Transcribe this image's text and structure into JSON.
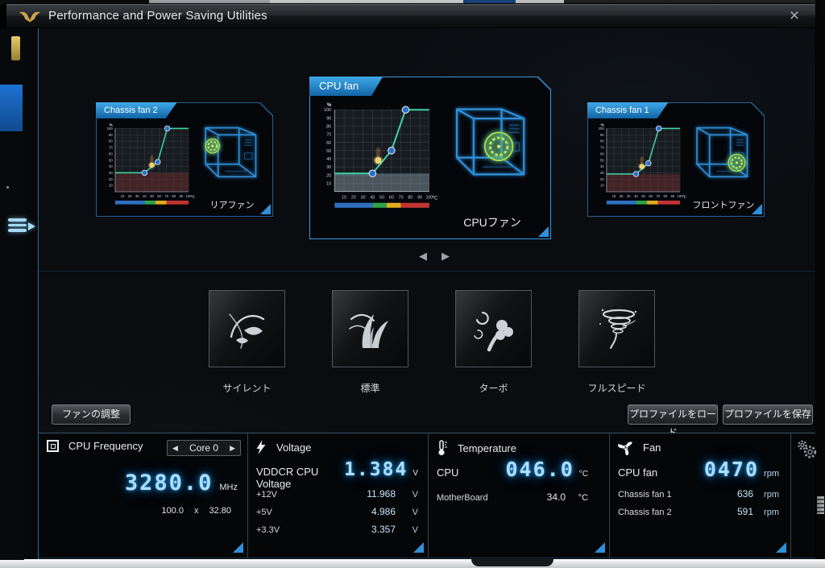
{
  "window": {
    "title": "Performance and Power Saving Utilities",
    "close_glyph": "×"
  },
  "icons": {
    "titlebar_logo": "tuf-eagle-logo",
    "menu_handle": "slide-out-menu-icon",
    "cpu_frequency": "chip-icon",
    "voltage": "lightning-icon",
    "temperature": "thermometer-icon",
    "fan": "fan-icon",
    "settings": "gears-icon"
  },
  "carousel": {
    "prev_glyph": "◀",
    "next_glyph": "▶"
  },
  "fan_cards": [
    {
      "title": "Chassis fan 2",
      "fan_label": "リアファン",
      "fan_position": "rear",
      "selected": false
    },
    {
      "title": "CPU fan",
      "fan_label": "CPUファン",
      "fan_position": "center",
      "selected": true
    },
    {
      "title": "Chassis fan 1",
      "fan_label": "フロントファン",
      "fan_position": "front",
      "selected": false
    }
  ],
  "modes": [
    {
      "label": "サイレント",
      "icon": "silent-leaf-wind-icon"
    },
    {
      "label": "標準",
      "icon": "standard-grass-wind-icon"
    },
    {
      "label": "ターボ",
      "icon": "turbo-wind-flower-icon"
    },
    {
      "label": "フルスピード",
      "icon": "full-speed-tornado-icon"
    }
  ],
  "actions": {
    "fan_tuning": "ファンの調整",
    "load_profile": "プロファイルをロード",
    "save_profile": "プロファイルを保存"
  },
  "monitor": {
    "cpu_frequency": {
      "title": "CPU Frequency",
      "selector_prev": "◀",
      "selector_value": "Core 0",
      "selector_next": "▶",
      "value": "3280.0",
      "unit": "MHz",
      "bclk": "100.0",
      "mult_sign": "x",
      "multiplier": "32.80"
    },
    "voltage": {
      "title": "Voltage",
      "main_label": "VDDCR CPU Voltage",
      "main_value": "1.384",
      "main_unit": "V",
      "rows": [
        {
          "label": "+12V",
          "value": "11.968",
          "unit": "V"
        },
        {
          "label": "+5V",
          "value": "4.986",
          "unit": "V"
        },
        {
          "label": "+3.3V",
          "value": "3.357",
          "unit": "V"
        }
      ]
    },
    "temperature": {
      "title": "Temperature",
      "main_label": "CPU",
      "main_value": "046.0",
      "main_unit": "°C",
      "rows": [
        {
          "label": "MotherBoard",
          "value": "34.0",
          "unit": "°C"
        }
      ]
    },
    "fan": {
      "title": "Fan",
      "main_label": "CPU fan",
      "main_value": "0470",
      "main_unit": "rpm",
      "rows": [
        {
          "label": "Chassis fan 1",
          "value": "636",
          "unit": "rpm"
        },
        {
          "label": "Chassis fan 2",
          "value": "591",
          "unit": "rpm"
        }
      ]
    }
  },
  "colors": {
    "accent_blue": "#1e8fd5",
    "tab_blue": "#1a7fd0",
    "glow_value": "#ace0ff",
    "curve_green": "#3ed3a3",
    "point_blue": "#2e6fc4",
    "marker_yellow": "#f2cf58",
    "triangle_blue": "#2f8fd8",
    "case_wire_blue": "#2e8fd8",
    "fan_green": "#a9de45"
  },
  "chart_data": [
    {
      "name": "Chassis fan 2",
      "type": "line",
      "xlabel": "℃",
      "ylabel": "%",
      "xticks": [
        10,
        20,
        30,
        40,
        50,
        60,
        70,
        80,
        90,
        100
      ],
      "yticks": [
        10,
        20,
        30,
        40,
        50,
        60,
        70,
        80,
        90,
        100
      ],
      "xlim": [
        0,
        100
      ],
      "ylim": [
        0,
        100
      ],
      "grid": true,
      "curve": [
        [
          0,
          30
        ],
        [
          40,
          30
        ],
        [
          58,
          47
        ],
        [
          71,
          100
        ],
        [
          100,
          100
        ]
      ],
      "points": [
        [
          40,
          30
        ],
        [
          58,
          47
        ],
        [
          71,
          100
        ]
      ],
      "current_marker": [
        50,
        42
      ],
      "curve_color": "#3ed3a3",
      "point_color": "#2e6fc4",
      "marker_color": "#f2cf58",
      "shade_color": "rgba(120,45,45,0.45)",
      "temp_zones": [
        {
          "from": 10,
          "to": 40,
          "color": "#2e6fc0"
        },
        {
          "from": 40,
          "to": 55,
          "color": "#2fa24c"
        },
        {
          "from": 55,
          "to": 70,
          "color": "#ddad1f"
        },
        {
          "from": 70,
          "to": 100,
          "color": "#c23434"
        }
      ]
    },
    {
      "name": "CPU fan",
      "type": "line",
      "xlabel": "℃",
      "ylabel": "%",
      "xticks": [
        10,
        20,
        30,
        40,
        50,
        60,
        70,
        80,
        90,
        100
      ],
      "yticks": [
        10,
        20,
        30,
        40,
        50,
        60,
        70,
        80,
        90,
        100
      ],
      "xlim": [
        0,
        100
      ],
      "ylim": [
        0,
        100
      ],
      "grid": true,
      "curve": [
        [
          0,
          22
        ],
        [
          40,
          22
        ],
        [
          60,
          50
        ],
        [
          75,
          100
        ],
        [
          100,
          100
        ]
      ],
      "points": [
        [
          40,
          22
        ],
        [
          60,
          50
        ],
        [
          75,
          100
        ]
      ],
      "current_marker": [
        46,
        38
      ],
      "curve_color": "#3ed3a3",
      "point_color": "#2e6fc4",
      "marker_color": "#f2cf58",
      "shade_color": "rgba(128,142,156,0.5)",
      "temp_zones": [
        {
          "from": 10,
          "to": 40,
          "color": "#2e6fc0"
        },
        {
          "from": 40,
          "to": 55,
          "color": "#2fa24c"
        },
        {
          "from": 55,
          "to": 70,
          "color": "#ddad1f"
        },
        {
          "from": 70,
          "to": 100,
          "color": "#c23434"
        }
      ]
    },
    {
      "name": "Chassis fan 1",
      "type": "line",
      "xlabel": "℃",
      "ylabel": "%",
      "xticks": [
        10,
        20,
        30,
        40,
        50,
        60,
        70,
        80,
        90,
        100
      ],
      "yticks": [
        10,
        20,
        30,
        40,
        50,
        60,
        70,
        80,
        90,
        100
      ],
      "xlim": [
        0,
        100
      ],
      "ylim": [
        0,
        100
      ],
      "grid": true,
      "curve": [
        [
          0,
          28
        ],
        [
          40,
          28
        ],
        [
          57,
          45
        ],
        [
          71,
          100
        ],
        [
          100,
          100
        ]
      ],
      "points": [
        [
          40,
          28
        ],
        [
          57,
          45
        ],
        [
          71,
          100
        ]
      ],
      "current_marker": [
        48,
        40
      ],
      "curve_color": "#3ed3a3",
      "point_color": "#2e6fc4",
      "marker_color": "#f2cf58",
      "shade_color": "rgba(120,45,45,0.45)",
      "temp_zones": [
        {
          "from": 10,
          "to": 40,
          "color": "#2e6fc0"
        },
        {
          "from": 40,
          "to": 55,
          "color": "#2fa24c"
        },
        {
          "from": 55,
          "to": 70,
          "color": "#ddad1f"
        },
        {
          "from": 70,
          "to": 100,
          "color": "#c23434"
        }
      ]
    }
  ]
}
